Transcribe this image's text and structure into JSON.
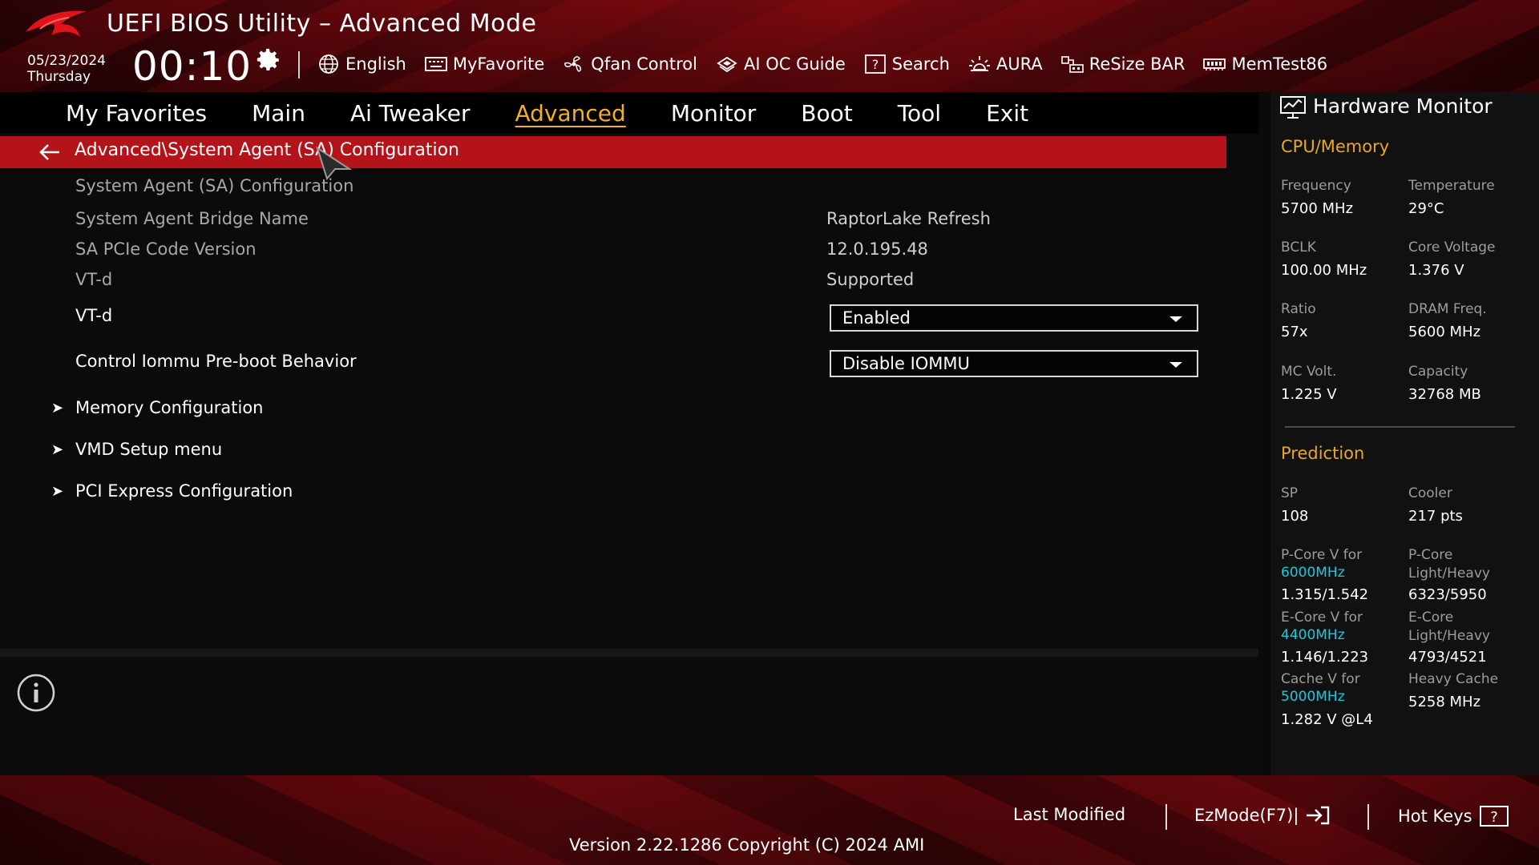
{
  "header": {
    "title": "UEFI BIOS Utility – Advanced Mode",
    "date": "05/23/2024",
    "day": "Thursday",
    "time": "00:10",
    "toolbar": [
      {
        "label": "English",
        "icon": "globe-icon"
      },
      {
        "label": "MyFavorite",
        "icon": "keyboard-icon"
      },
      {
        "label": "Qfan Control",
        "icon": "fan-icon"
      },
      {
        "label": "AI OC Guide",
        "icon": "chip-icon"
      },
      {
        "label": "Search",
        "icon": "help-box-icon"
      },
      {
        "label": "AURA",
        "icon": "aura-light-icon"
      },
      {
        "label": "ReSize BAR",
        "icon": "resize-bar-icon"
      },
      {
        "label": "MemTest86",
        "icon": "memory-icon"
      }
    ]
  },
  "nav": {
    "tabs": [
      "My Favorites",
      "Main",
      "Ai Tweaker",
      "Advanced",
      "Monitor",
      "Boot",
      "Tool",
      "Exit"
    ],
    "active": "Advanced"
  },
  "main": {
    "breadcrumb": "Advanced\\System Agent (SA) Configuration",
    "section_heading": "System Agent (SA) Configuration",
    "info_rows": [
      {
        "label": "System Agent Bridge Name",
        "value": "RaptorLake Refresh"
      },
      {
        "label": "SA PCIe Code Version",
        "value": "12.0.195.48"
      },
      {
        "label": "VT-d",
        "value": "Supported"
      }
    ],
    "settings": [
      {
        "label": "VT-d",
        "value": "Enabled"
      },
      {
        "label": "Control Iommu Pre-boot Behavior",
        "value": "Disable IOMMU"
      }
    ],
    "submenus": [
      "Memory Configuration",
      "VMD Setup menu",
      "PCI Express Configuration"
    ]
  },
  "hardware_monitor": {
    "title": "Hardware Monitor",
    "cpu_memory": {
      "heading": "CPU/Memory",
      "items": [
        {
          "label": "Frequency",
          "value": "5700 MHz"
        },
        {
          "label": "Temperature",
          "value": "29°C"
        },
        {
          "label": "BCLK",
          "value": "100.00 MHz"
        },
        {
          "label": "Core Voltage",
          "value": "1.376 V"
        },
        {
          "label": "Ratio",
          "value": "57x"
        },
        {
          "label": "DRAM Freq.",
          "value": "5600 MHz"
        },
        {
          "label": "MC Volt.",
          "value": "1.225 V"
        },
        {
          "label": "Capacity",
          "value": "32768 MB"
        }
      ]
    },
    "prediction": {
      "heading": "Prediction",
      "sp_label": "SP",
      "sp_value": "108",
      "cooler_label": "Cooler",
      "cooler_value": "217 pts",
      "pcore_v_label": "P-Core V for",
      "pcore_v_freq": "6000MHz",
      "pcore_v_value": "1.315/1.542",
      "pcore_lh_label_1": "P-Core",
      "pcore_lh_label_2": "Light/Heavy",
      "pcore_lh_value": "6323/5950",
      "ecore_v_label": "E-Core V for",
      "ecore_v_freq": "4400MHz",
      "ecore_v_value": "1.146/1.223",
      "ecore_lh_label_1": "E-Core",
      "ecore_lh_label_2": "Light/Heavy",
      "ecore_lh_value": "4793/4521",
      "cache_v_label": "Cache V for",
      "cache_v_freq": "5000MHz",
      "cache_v_value": "1.282 V @L4",
      "heavy_cache_label": "Heavy Cache",
      "heavy_cache_value": "5258 MHz"
    }
  },
  "footer": {
    "last_modified": "Last Modified",
    "ezmode": "EzMode(F7)|",
    "hot_keys": "Hot Keys",
    "version": "Version 2.22.1286 Copyright (C) 2024 AMI"
  },
  "colors": {
    "accent_red": "#b5131a",
    "active_tab": "#f0b020",
    "section_heading": "#e8a822",
    "frequency_cyan": "#1ec8dc"
  }
}
